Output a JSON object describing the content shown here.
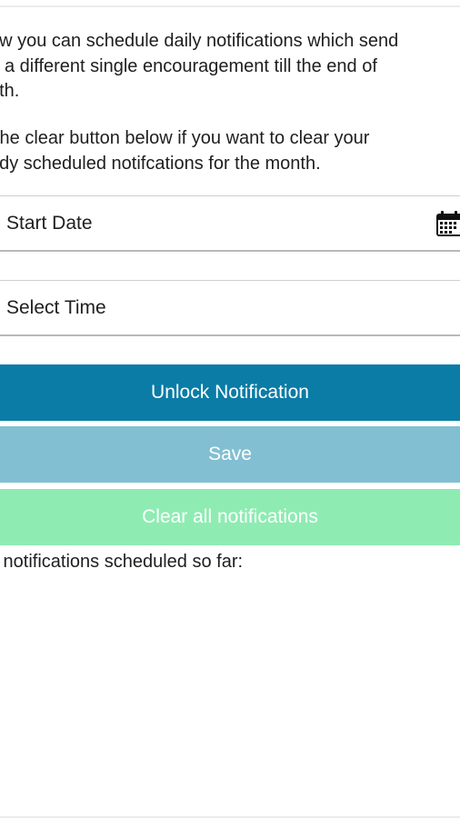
{
  "intro": {
    "paragraph1_lines": [
      "ow you can schedule daily notifications which send",
      "a different single encouragement till the end of",
      "nth."
    ],
    "paragraph2_lines": [
      "the clear button below if you want to clear your",
      "ady scheduled notifcations for the month."
    ]
  },
  "form": {
    "start_date_label": "Start Date",
    "start_date_icon": "calendar-icon",
    "select_time_label": "Select Time"
  },
  "buttons": {
    "unlock_label": "Unlock Notification",
    "save_label": "Save",
    "clear_label": "Clear all notifications"
  },
  "scheduled": {
    "label": "s notifications scheduled so far:"
  },
  "colors": {
    "unlock_button": "#0a7ca6",
    "save_button": "#82bfd2",
    "clear_button": "#8eecb2"
  }
}
